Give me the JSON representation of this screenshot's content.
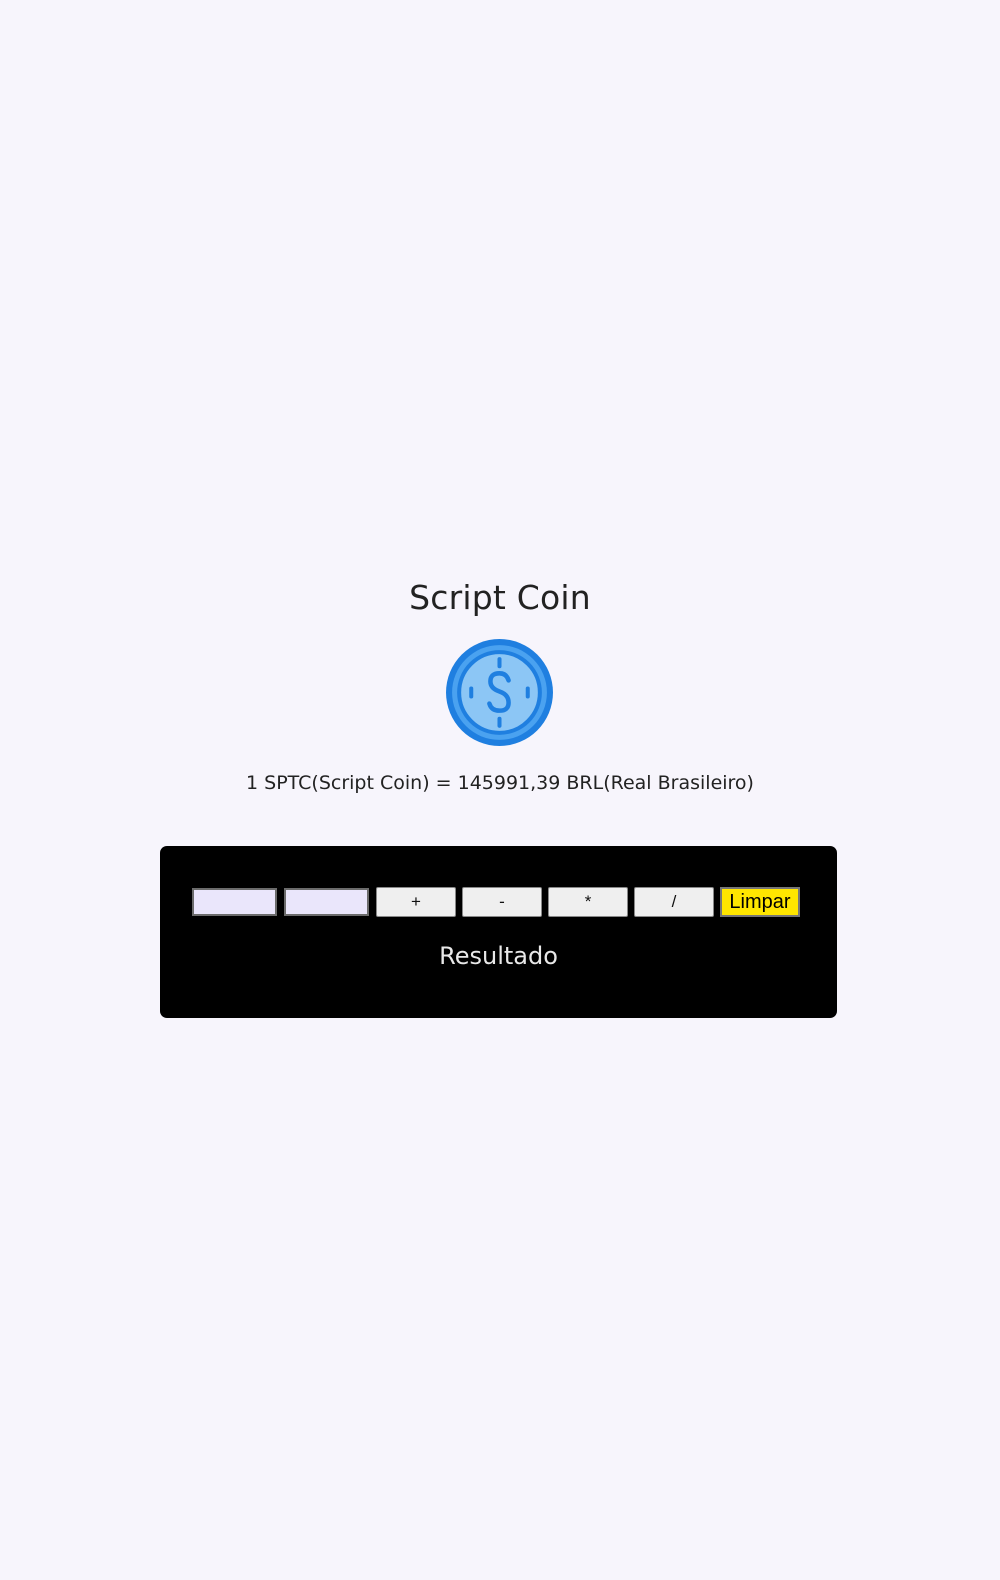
{
  "header": {
    "title": "Script Coin"
  },
  "coin": {
    "icon": "dollar-coin-icon",
    "colors": {
      "outer": "#1f7fe0",
      "inner": "#8cc6f5",
      "symbol": "#1f7fe0"
    }
  },
  "rate": {
    "text": "1 SPTC(Script Coin) = 145991,39 BRL(Real Brasileiro)"
  },
  "calculator": {
    "input1": {
      "value": "",
      "placeholder": ""
    },
    "input2": {
      "value": "",
      "placeholder": ""
    },
    "buttons": {
      "add": "+",
      "subtract": "-",
      "multiply": "*",
      "divide": "/",
      "clear": "Limpar"
    },
    "result": "Resultado",
    "colors": {
      "panel": "#000000",
      "clear_button": "#ffe600",
      "input_background": "#eae6fb"
    }
  }
}
